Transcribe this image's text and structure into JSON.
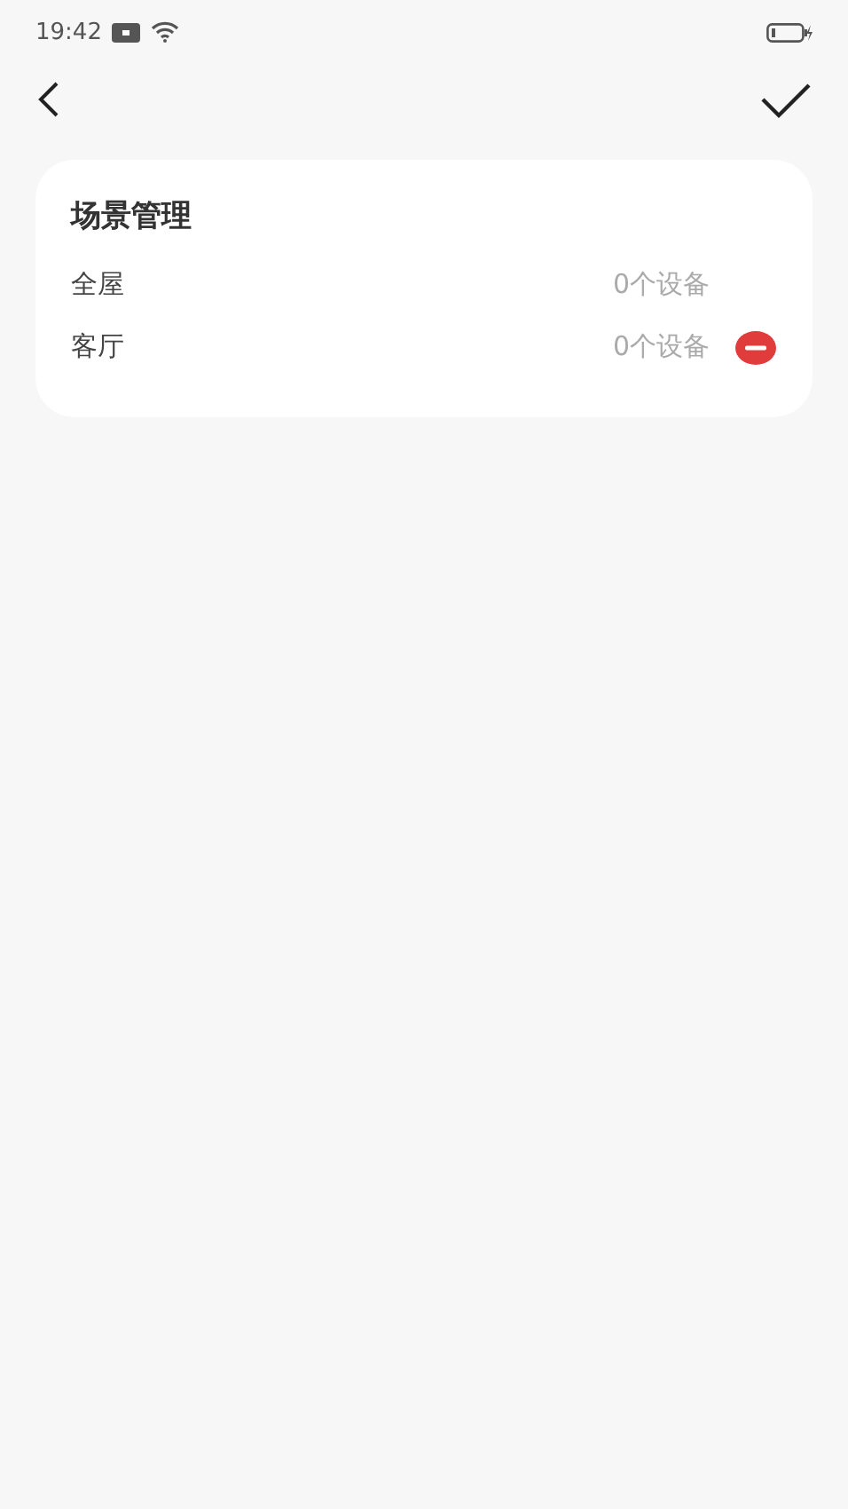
{
  "status_bar": {
    "time": "19:42"
  },
  "card": {
    "title": "场景管理",
    "rows": [
      {
        "name": "全屋",
        "count": "0个设备",
        "removable": false
      },
      {
        "name": "客厅",
        "count": "0个设备",
        "removable": true
      }
    ]
  }
}
